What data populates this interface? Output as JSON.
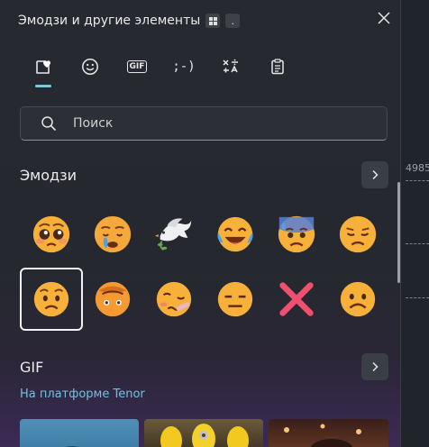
{
  "window": {
    "title": "Эмодзи и другие элементы",
    "shortcut_hint": "."
  },
  "tabs": [
    {
      "icon": "heart-sticker-icon",
      "selected": true
    },
    {
      "icon": "smiley-icon"
    },
    {
      "icon": "gif-icon",
      "label": "GIF"
    },
    {
      "icon": "kaomoji-icon",
      "label": ";-)"
    },
    {
      "icon": "symbols-icon"
    },
    {
      "icon": "clipboard-icon"
    }
  ],
  "search": {
    "placeholder": "Поиск",
    "value": ""
  },
  "emoji_section": {
    "title": "Эмодзи",
    "items": [
      {
        "name": "pleading-face"
      },
      {
        "name": "crying-face"
      },
      {
        "name": "dove"
      },
      {
        "name": "face-with-tears-of-joy"
      },
      {
        "name": "anxious-face-with-sweat"
      },
      {
        "name": "disappointed-face"
      },
      {
        "name": "worried-face",
        "selected": true
      },
      {
        "name": "face-peeking-upside-down"
      },
      {
        "name": "woozy-face"
      },
      {
        "name": "expressionless-face"
      },
      {
        "name": "cross-mark"
      },
      {
        "name": "frowning-face"
      }
    ]
  },
  "gif_section": {
    "title": "GIF",
    "provider": "На платформе Tenor"
  },
  "background_app": {
    "number": "4985"
  },
  "colors": {
    "accent": "#6ad0e2",
    "link": "#6cc3e6",
    "panel": "#262a30"
  }
}
